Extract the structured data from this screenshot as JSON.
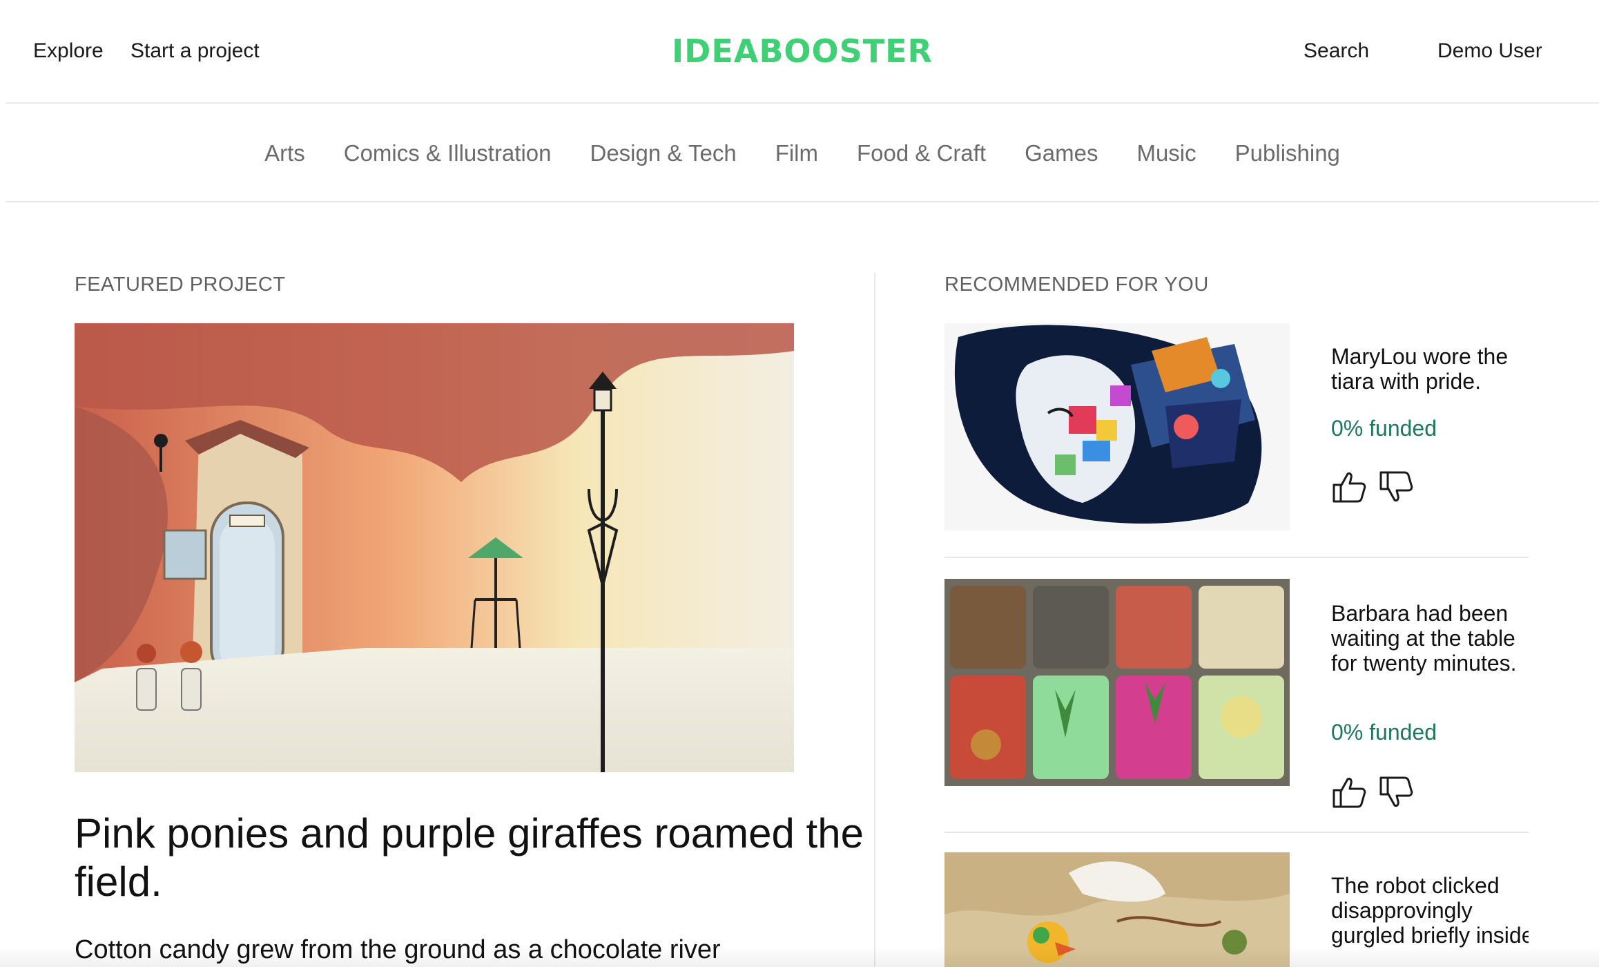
{
  "header": {
    "explore_label": "Explore",
    "start_project_label": "Start a project",
    "logo_text": "IDEABOOSTER",
    "search_label": "Search",
    "user_label": "Demo User"
  },
  "categories": [
    "Arts",
    "Comics & Illustration",
    "Design & Tech",
    "Film",
    "Food & Craft",
    "Games",
    "Music",
    "Publishing"
  ],
  "featured": {
    "section_label": "FEATURED PROJECT",
    "title": "Pink ponies and purple giraffes roamed the field.",
    "blurb": "Cotton candy grew from the ground as a chocolate river"
  },
  "recommended": {
    "section_label": "RECOMMENDED FOR YOU",
    "items": [
      {
        "title": "MaryLou wore the tiara with pride.",
        "funded": "0% funded"
      },
      {
        "title": "Barbara had been waiting at the table for twenty minutes.",
        "funded": "0% funded"
      },
      {
        "title": "The robot clicked disapprovingly gurgled briefly inside"
      }
    ]
  },
  "colors": {
    "brand_green": "#3fcf74",
    "funded_green": "#1c7a5a",
    "nav_gray": "#6b6b6b"
  },
  "icons": [
    "thumbs-up-icon",
    "thumbs-down-icon"
  ]
}
